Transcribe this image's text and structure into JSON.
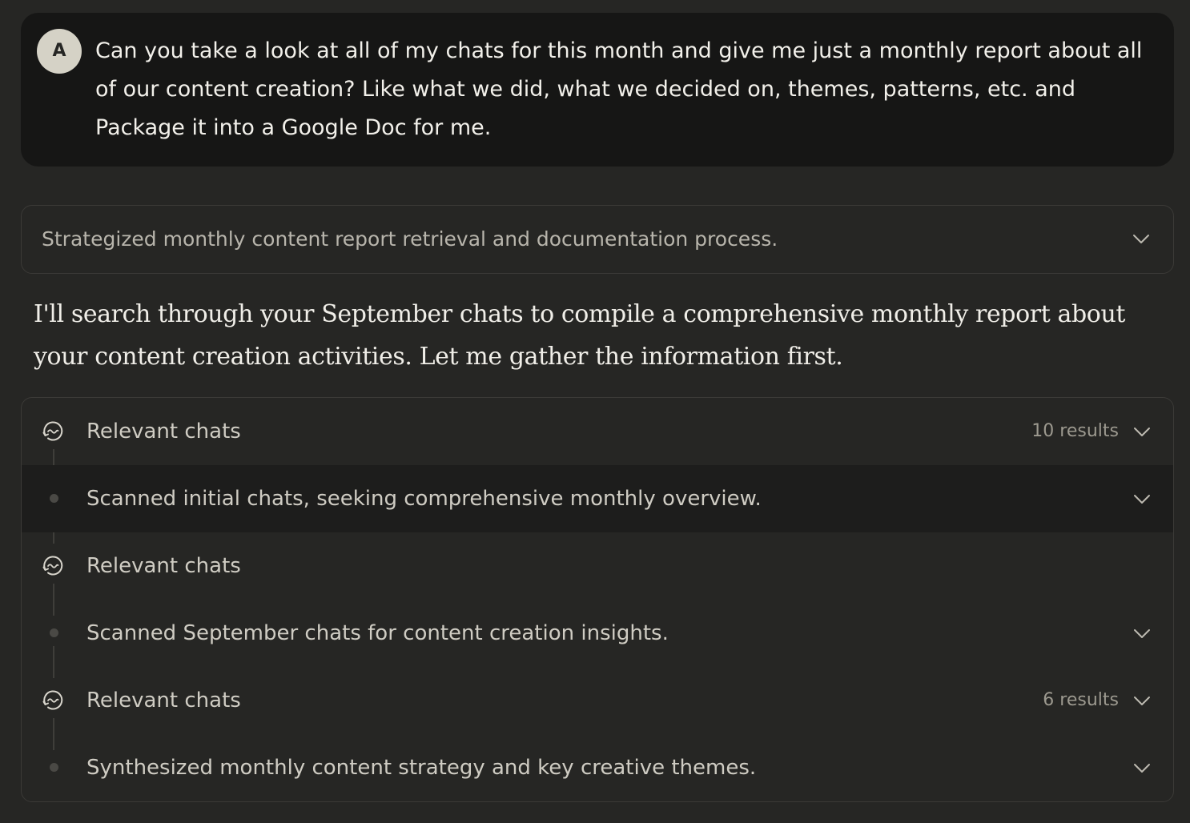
{
  "user_message": {
    "avatar_initial": "A",
    "text": "Can you take a look at all of my chats for this month and give me just a monthly report about all of our content creation? Like what we did, what we decided on, themes, patterns, etc. and Package it into a Google Doc for me."
  },
  "thinking_summary": {
    "text": "Strategized monthly content report retrieval and documentation process.",
    "icon": "chevron-down-icon"
  },
  "assistant_message": {
    "text": "I'll search through your September chats to compile a comprehensive monthly report about your content creation activities. Let me gather the information first."
  },
  "tool_steps": [
    {
      "type": "tool",
      "label": "Relevant chats",
      "count": "10 results",
      "icon": "chat-search-icon"
    },
    {
      "type": "thought",
      "label": "Scanned initial chats, seeking comprehensive monthly overview."
    },
    {
      "type": "tool",
      "label": "Relevant chats",
      "count": "",
      "icon": "chat-search-icon"
    },
    {
      "type": "thought",
      "label": "Scanned September chats for content creation insights."
    },
    {
      "type": "tool",
      "label": "Relevant chats",
      "count": "6 results",
      "icon": "chat-search-icon"
    },
    {
      "type": "thought",
      "label": "Synthesized monthly content strategy and key creative themes."
    }
  ],
  "colors": {
    "background": "#262624",
    "user_bubble": "#161615",
    "highlight_row": "#1d1d1c",
    "border": "#3b3a37"
  }
}
